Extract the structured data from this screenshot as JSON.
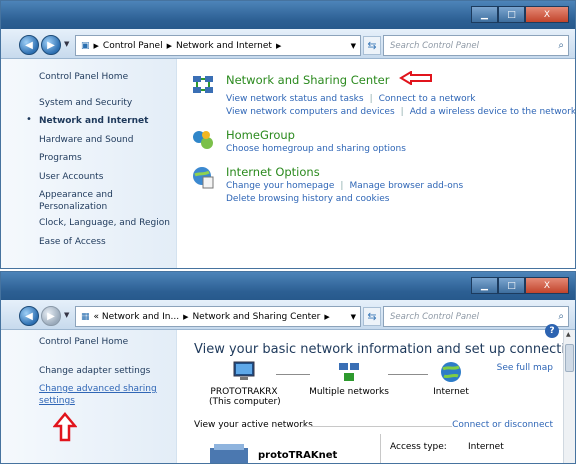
{
  "window1": {
    "controls": {
      "minimize": "▁",
      "maximize": "□",
      "close": "X"
    },
    "breadcrumb": [
      "Control Panel",
      "Network and Internet"
    ],
    "search_placeholder": "Search Control Panel",
    "sidebar": {
      "home": "Control Panel Home",
      "items": [
        "System and Security",
        "Network and Internet",
        "Hardware and Sound",
        "Programs",
        "User Accounts",
        "Appearance and Personalization",
        "Clock, Language, and Region",
        "Ease of Access"
      ]
    },
    "categories": [
      {
        "title": "Network and Sharing Center",
        "links": [
          [
            "View network status and tasks",
            "Connect to a network"
          ],
          [
            "View network computers and devices",
            "Add a wireless device to the network"
          ]
        ]
      },
      {
        "title": "HomeGroup",
        "links": [
          [
            "Choose homegroup and sharing options"
          ]
        ]
      },
      {
        "title": "Internet Options",
        "links": [
          [
            "Change your homepage",
            "Manage browser add-ons"
          ],
          [
            "Delete browsing history and cookies"
          ]
        ]
      }
    ]
  },
  "window2": {
    "controls": {
      "minimize": "▁",
      "maximize": "□",
      "close": "X"
    },
    "breadcrumb": [
      "« Network and In...",
      "Network and Sharing Center"
    ],
    "search_placeholder": "Search Control Panel",
    "sidebar": {
      "home": "Control Panel Home",
      "adapter": "Change adapter settings",
      "advanced": "Change advanced sharing settings"
    },
    "main": {
      "heading": "View your basic network information and set up connections",
      "see_full_map": "See full map",
      "nodes": [
        {
          "name": "PROTOTRAKRX",
          "sub": "(This computer)"
        },
        {
          "name": "Multiple networks"
        },
        {
          "name": "Internet"
        }
      ],
      "active_networks": "View your active networks",
      "connect_disconnect": "Connect or disconnect",
      "network_name": "protoTRAKnet",
      "access_type_label": "Access type:",
      "access_type_value": "Internet"
    }
  },
  "colors": {
    "title_link": "#2b8a1e",
    "link": "#2f66b6",
    "arrow": "#e1141c",
    "titlebar": "#2c5f93"
  }
}
